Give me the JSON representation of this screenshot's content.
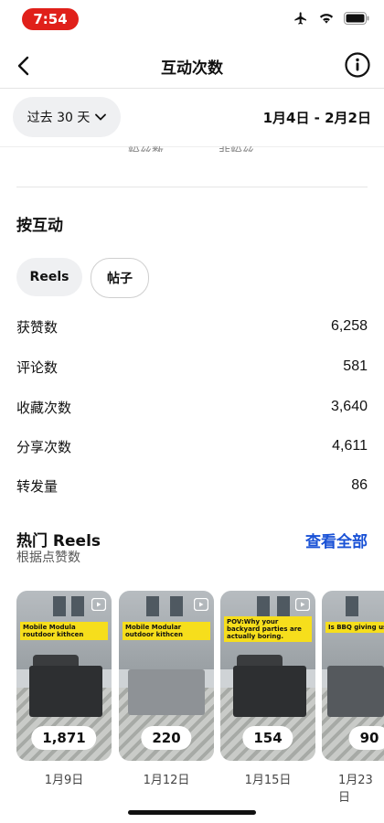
{
  "status": {
    "time": "7:54"
  },
  "nav": {
    "title": "互动次数"
  },
  "filter": {
    "period": "过去 30 天",
    "date_range": "1月4日 - 2月2日"
  },
  "legend_partial": [
    "粉丝数",
    "非粉丝"
  ],
  "interactions": {
    "title": "按互动",
    "tabs": [
      "Reels",
      "帖子"
    ],
    "metrics": [
      {
        "label": "获赞数",
        "value": "6,258"
      },
      {
        "label": "评论数",
        "value": "581"
      },
      {
        "label": "收藏次数",
        "value": "3,640"
      },
      {
        "label": "分享次数",
        "value": "4,611"
      },
      {
        "label": "转发量",
        "value": "86"
      }
    ]
  },
  "top_reels": {
    "title": "热门 Reels",
    "subtitle": "根据点赞数",
    "see_all": "查看全部",
    "items": [
      {
        "caption": "Mobile Modula routdoor kithcen",
        "count": "1,871",
        "date": "1月9日"
      },
      {
        "caption": "Mobile Modular outdoor kithcen",
        "count": "220",
        "date": "1月12日"
      },
      {
        "caption": "POV:Why your backyard parties are actually boring.",
        "count": "154",
        "date": "1月15日"
      },
      {
        "caption": "Is BBQ giving us ca",
        "count": "90",
        "date": "1月23日"
      }
    ]
  },
  "colors": {
    "accent": "#1a52d6",
    "caption_bg": "#f6de1c",
    "time_pill": "#e0201a"
  }
}
